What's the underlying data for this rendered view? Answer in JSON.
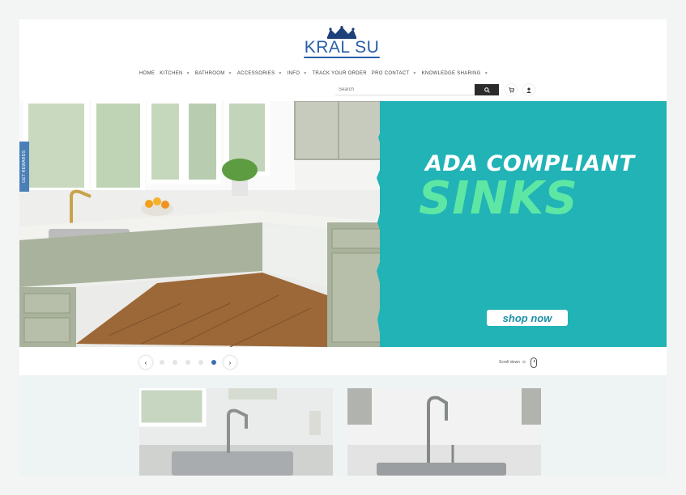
{
  "brand": {
    "name": "KRAL SU",
    "logo_color": "#2a5ea8"
  },
  "nav": {
    "items": [
      {
        "label": "HOME",
        "chevron": false
      },
      {
        "label": "KITCHEN",
        "chevron": true
      },
      {
        "label": "BATHROOM",
        "chevron": true
      },
      {
        "label": "ACCESSORIES",
        "chevron": true
      },
      {
        "label": "INFO",
        "chevron": true
      },
      {
        "label": "TRACK YOUR ORDER",
        "chevron": false
      },
      {
        "label": "PRO CONTACT",
        "chevron": true
      },
      {
        "label": "KNOWLEDGE SHARING",
        "chevron": true
      }
    ]
  },
  "search": {
    "placeholder": "Search",
    "button_icon": "search-icon"
  },
  "header_icons": [
    "cart-icon",
    "user-icon"
  ],
  "side_tab": {
    "label": "GET REWARDS"
  },
  "hero": {
    "headline": "ADA COMPLIANT",
    "subheadline": "SINKS",
    "cta": "shop now",
    "bg_color": "#21b3b6",
    "accent_color": "#5ee7a4"
  },
  "slider": {
    "slide_count": 5,
    "active_index": 4
  },
  "scroll_down": {
    "label": "Scroll down"
  }
}
